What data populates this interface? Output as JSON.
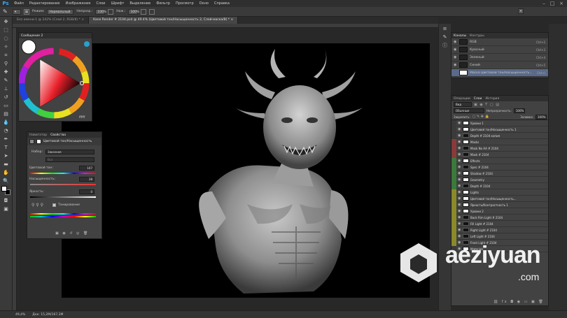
{
  "app": {
    "logo": "Ps"
  },
  "menu": [
    "Файл",
    "Редактирование",
    "Изображение",
    "Слои",
    "Шрифт",
    "Выделение",
    "Фильтр",
    "Просмотр",
    "Окно",
    "Справка"
  ],
  "options": {
    "mode_label": "Режим:",
    "mode_value": "Нормальный",
    "opacity_label": "Непрозр.:",
    "opacity_value": "100%",
    "flow_label": "Наж.:",
    "flow_value": "100%"
  },
  "tabs": [
    {
      "label": "Без имени-1 @ 242% (Слой 2, RGB/8) * ×",
      "active": false
    },
    {
      "label": "Kane Render # 2104.psd @ 49.4% (Цветовой тон/Насыщенность 2, Слой-маска/8) * ×",
      "active": true
    }
  ],
  "color_panel": {
    "title": "Сообщение 2",
    "swatch_label": "ffffff"
  },
  "properties": {
    "tabs": [
      "Навигатор",
      "Свойства"
    ],
    "header": "Цветовой тон/Насыщенность",
    "preset_label": "Набор:",
    "preset_value": "Заказная",
    "channel_value": "Все",
    "hue_label": "Цветовой тон:",
    "hue_value": "107",
    "sat_label": "Насыщенность:",
    "sat_value": "38",
    "light_label": "Яркость:",
    "light_value": "0",
    "colorize_label": "Тонирование"
  },
  "channels": {
    "tabs": [
      "Каналы",
      "Контуры"
    ],
    "rows": [
      {
        "name": "RGB",
        "shortcut": "Ctrl+2",
        "selected": false
      },
      {
        "name": "Красный",
        "shortcut": "Ctrl+3",
        "selected": false
      },
      {
        "name": "Зеленый",
        "shortcut": "Ctrl+4",
        "selected": false
      },
      {
        "name": "Синий",
        "shortcut": "Ctrl+5",
        "selected": false
      },
      {
        "name": "Маска Цветовой тон/Насыщенность 2",
        "shortcut": "Ctrl+\\",
        "selected": true
      }
    ]
  },
  "layers": {
    "tabs": [
      "Операции",
      "Слои",
      "История"
    ],
    "kind_value": "Вид",
    "blend_value": "Обычные",
    "opacity_label": "Непрозрачность:",
    "opacity_value": "100%",
    "lock_label": "Закрепить:",
    "fill_label": "Заливка:",
    "fill_value": "100%",
    "rows": [
      {
        "name": "Уровни 1",
        "color": "#3a3a3a",
        "dark": false
      },
      {
        "name": "Цветовой тон/Насыщенность 1",
        "color": "#3a3a3a",
        "dark": false
      },
      {
        "name": "Depth # 2104 копия",
        "color": "#3a3a3a",
        "dark": true
      },
      {
        "name": "Masks",
        "color": "#8a3a3a",
        "dark": false
      },
      {
        "name": "Mask No AA # 2104",
        "color": "#8a3a3a",
        "dark": true
      },
      {
        "name": "Mask # 2104",
        "color": "#8a3a3a",
        "dark": true
      },
      {
        "name": "Effects",
        "color": "#3a7a3a",
        "dark": false
      },
      {
        "name": "Spec # 2104",
        "color": "#3a7a3a",
        "dark": true
      },
      {
        "name": "Shadow # 2104",
        "color": "#3a7a3a",
        "dark": false
      },
      {
        "name": "Geometry",
        "color": "#3a7a3a",
        "dark": false
      },
      {
        "name": "Depth # 2104",
        "color": "#3a7a3a",
        "dark": true
      },
      {
        "name": "Lights",
        "color": "#8a8a2a",
        "dark": false
      },
      {
        "name": "Цветовой тон/Насыщенность...",
        "color": "#8a8a2a",
        "dark": false
      },
      {
        "name": "Яркость/Контрастность 1",
        "color": "#8a8a2a",
        "dark": false
      },
      {
        "name": "Уровни 2",
        "color": "#8a8a2a",
        "dark": false
      },
      {
        "name": "Back Rim Light # 2104",
        "color": "#8a8a2a",
        "dark": true
      },
      {
        "name": "Fill Light # 2104",
        "color": "#8a8a2a",
        "dark": true
      },
      {
        "name": "Right Light # 2104",
        "color": "#8a8a2a",
        "dark": true
      },
      {
        "name": "Left Light # 2104",
        "color": "#8a8a2a",
        "dark": true
      },
      {
        "name": "Front Light # 2104",
        "color": "#8a8a2a",
        "dark": true
      },
      {
        "name": "Materials",
        "color": "#3a3a3a",
        "dark": false
      }
    ]
  },
  "status": {
    "zoom": "49,4%",
    "doc": "Док: 15,2M/167,3M"
  },
  "watermark": "aeziyuan",
  "watermark_domain": ".com"
}
